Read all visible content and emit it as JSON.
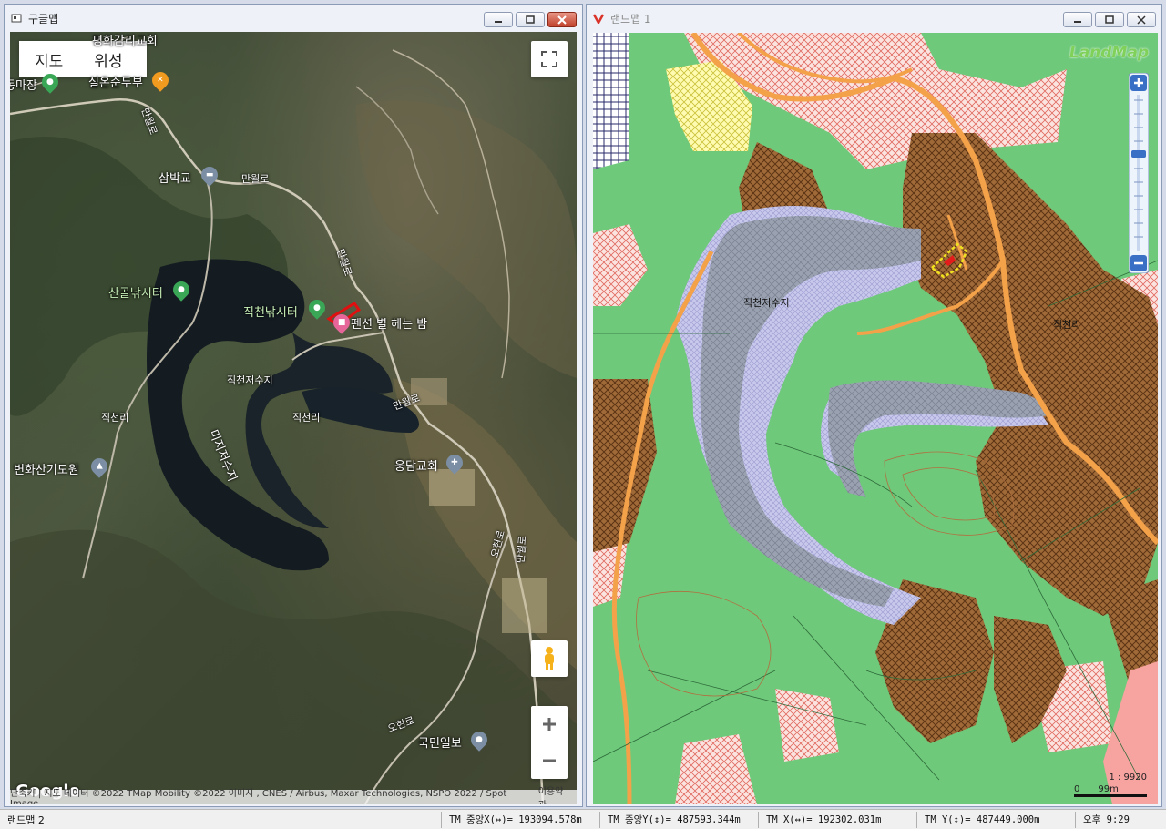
{
  "left_window": {
    "title": "구글맵",
    "map_type": {
      "map": "지도",
      "satellite": "위성"
    },
    "labels": {
      "church_top": "평화감리교회",
      "shop_top": "실온순두부",
      "place_left_top": "동마장",
      "road_manweol_1": "만월로",
      "road_manweol_2": "만월로",
      "road_manweol_3": "만월로",
      "road_manweol_4": "만월로",
      "bridge": "삼박교",
      "fishing_1": "산골낚시터",
      "fishing_2": "직천낚시터",
      "pension": "펜션 별 헤는 밤",
      "reservoir_1": "직천저수지",
      "reservoir_2": "미지저수지",
      "village_1": "직천리",
      "village_2": "직천리",
      "church_2": "웅담교회",
      "arboretum": "변화산기도원",
      "road_ohyeon_1": "오현로",
      "road_ohyeon_2": "오현로",
      "road_manweol_5": "만월로",
      "news": "국민일보"
    },
    "attribution": {
      "text": "단축키 | 지도 데이터 ©2022 TMap Mobility ©2022 이미지 , CNES / Airbus, Maxar Technologies, NSPO 2022 / Spot Image",
      "terms": "이용약관"
    },
    "google_logo": "Google"
  },
  "right_window": {
    "title": "랜드맵 1",
    "logo": "LandMap",
    "labels": {
      "reservoir": "직천저수지",
      "village": "직천리"
    },
    "scale": {
      "ratio": "1 : 9920",
      "distance": "99m",
      "zero": "0"
    }
  },
  "statusbar": {
    "app": "랜드맵 2",
    "tm_center_x": "TM 중앙X(↔)= 193094.578m",
    "tm_center_y": "TM 중앙Y(↕)= 487593.344m",
    "tm_x": "TM X(↔)= 192302.031m",
    "tm_y": "TM Y(↕)= 487449.000m",
    "clock": "오후 9:29"
  },
  "colors": {
    "forest": "#6fc97a",
    "water": "#8f97a8",
    "road": "#f0a04b",
    "hatch_brown": "#8a5a2a",
    "hatch_pink": "#f4b7b0",
    "parcel_highlight": "#e8d21c"
  }
}
